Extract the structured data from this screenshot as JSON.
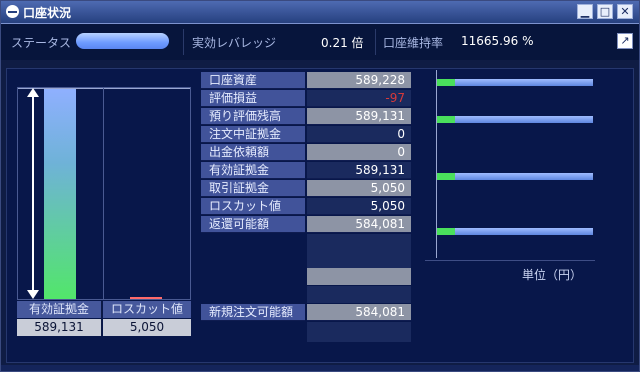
{
  "window": {
    "title": "口座状況",
    "buttons": {
      "minimize": "▁",
      "maximize": "□",
      "close": "✕"
    }
  },
  "status": {
    "status_label": "ステータス",
    "leverage_label": "実効レバレッジ",
    "leverage_value": "0.21 倍",
    "maintenance_label": "口座維持率",
    "maintenance_value": "11665.96 %",
    "external_button": "↗"
  },
  "gauge": {
    "headers": [
      "有効証拠金",
      "ロスカット値"
    ],
    "values": [
      "589,131",
      "5,050"
    ],
    "colors": {
      "effective": "#52e66a",
      "losscut": "#ff6a6a"
    }
  },
  "account_table": {
    "rows": [
      {
        "label": "口座資産",
        "value": "589,228"
      },
      {
        "label": "評価損益",
        "value": "-97"
      },
      {
        "label": "預り評価残高",
        "value": "589,131"
      },
      {
        "label": "注文中証拠金",
        "value": "0"
      },
      {
        "label": "出金依頼額",
        "value": "0"
      },
      {
        "label": "有効証拠金",
        "value": "589,131"
      },
      {
        "label": "取引証拠金",
        "value": "5,050"
      },
      {
        "label": "ロスカット値",
        "value": "5,050"
      },
      {
        "label": "返還可能額",
        "value": "584,081"
      }
    ],
    "new_order_label": "新規注文可能額",
    "new_order_value": "584,081"
  },
  "right_chart": {
    "unit_label": "単位（円）"
  }
}
